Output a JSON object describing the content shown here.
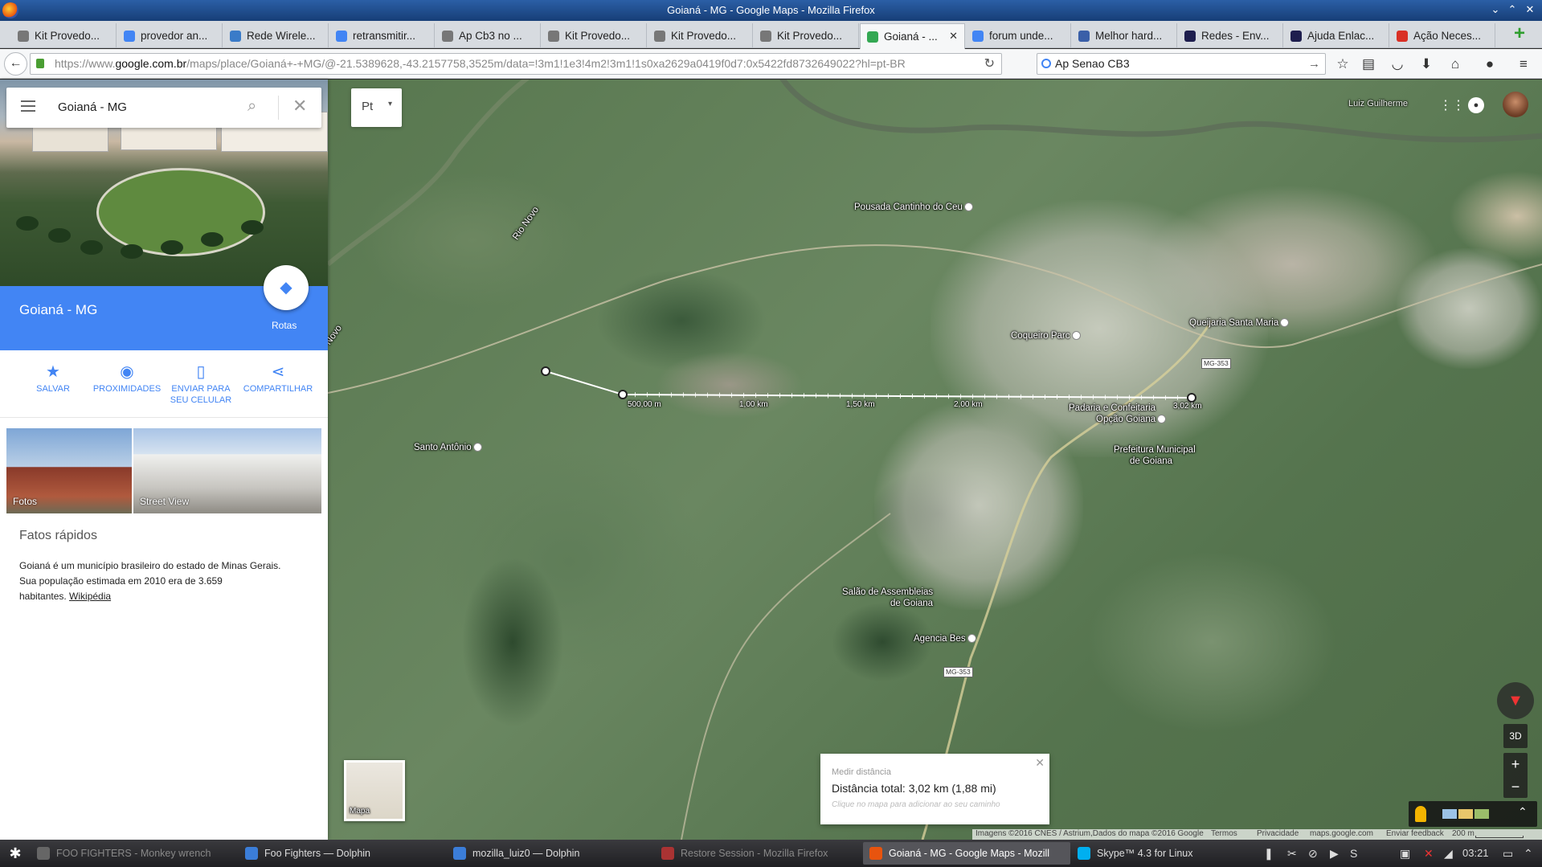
{
  "window_title": "Goianá - MG - Google Maps - Mozilla Firefox",
  "tabs": [
    {
      "label": "Kit Provedo...",
      "fav": "router-icon",
      "color": "#777"
    },
    {
      "label": "provedor an...",
      "fav": "google-icon",
      "color": "#4285f4"
    },
    {
      "label": "Rede Wirele...",
      "fav": "forum-icon",
      "color": "#3a7bc8"
    },
    {
      "label": "retransmitir...",
      "fav": "google-icon",
      "color": "#4285f4"
    },
    {
      "label": "Ap Cb3 no ...",
      "fav": "router-icon",
      "color": "#777"
    },
    {
      "label": "Kit Provedo...",
      "fav": "router-icon",
      "color": "#777"
    },
    {
      "label": "Kit Provedo...",
      "fav": "router-icon",
      "color": "#777"
    },
    {
      "label": "Kit Provedo...",
      "fav": "router-icon",
      "color": "#777"
    },
    {
      "label": "Goianá - ...",
      "fav": "maps-icon",
      "color": "#34a853",
      "active": true
    },
    {
      "label": "forum unde...",
      "fav": "google-icon",
      "color": "#4285f4"
    },
    {
      "label": "Melhor hard...",
      "fav": "monitor-icon",
      "color": "#3a5fa8"
    },
    {
      "label": "Redes - Env...",
      "fav": "vscode-icon",
      "color": "#1e1e4e"
    },
    {
      "label": "Ajuda Enlac...",
      "fav": "vscode-icon",
      "color": "#1e1e4e"
    },
    {
      "label": "Ação Neces...",
      "fav": "gmail-icon",
      "color": "#d93025"
    }
  ],
  "nav": {
    "url_prefix": "https://www.",
    "url_domain": "google.com.br",
    "url_rest": "/maps/place/Goianá+-+MG/@-21.5389628,-43.2157758,3525m/data=!3m1!1e3!4m2!3m1!1s0xa2629a0419f0d7:0x5422fd8732649022?hl=pt-BR",
    "search_value": "Ap Senao CB3"
  },
  "panel": {
    "search_query": "Goianá - MG",
    "place_title": "Goianá - MG",
    "route_label": "Rotas",
    "actions": [
      {
        "label": "SALVAR",
        "icon": "star-icon"
      },
      {
        "label": "PROXIMIDADES",
        "icon": "pin-icon"
      },
      {
        "label": "ENVIAR PARA SEU CELULAR",
        "icon": "phone-icon"
      },
      {
        "label": "COMPARTILHAR",
        "icon": "share-icon"
      }
    ],
    "photos_label": "Fotos",
    "streetview_label": "Street View",
    "facts_title": "Fatos rápidos",
    "facts_line1": "Goianá é um município brasileiro do estado de Minas Gerais.",
    "facts_line2": "Sua população estimada em 2010 era de 3.659",
    "facts_line3_prefix": "habitantes. ",
    "facts_link": "Wikipédia"
  },
  "map": {
    "language": "Pt",
    "user_name": "Luiz Guilherme",
    "labels": {
      "river1": "Rio Novo",
      "river2": "Novo",
      "pousada": "Pousada Cantinho do Ceu",
      "coqueiro": "Coqueiro Parc",
      "queijaria": "Queijaria Santa Maria",
      "padaria1": "Padaria e Confeitaria",
      "padaria2": "Opção Goiana",
      "prefeitura1": "Prefeitura Municipal",
      "prefeitura2": "de Goiana",
      "santo": "Santo Antônio",
      "salao1": "Salão de Assembleias",
      "salao2": "de Goiana",
      "agencia": "Agencia Bes",
      "road1": "MG-353",
      "road2": "MG-353"
    },
    "ruler_ticks": [
      "500,00 m",
      "1,00 km",
      "1,50 km",
      "2,00 km",
      "3,02 km"
    ],
    "minimap_label": "Mapa",
    "measure_title": "Medir distância",
    "measure_total": "Distância total: 3,02 km (1,88 mi)",
    "measure_hint": "Clique no mapa para adicionar ao seu caminho",
    "btn_3d": "3D",
    "zoom_in": "+",
    "zoom_out": "−",
    "footer": {
      "imagery": "Imagens ©2016 CNES / Astrium,Dados do mapa ©2016 Google",
      "terms": "Termos",
      "privacy": "Privacidade",
      "domain": "maps.google.com",
      "feedback": "Enviar feedback",
      "scale": "200 m"
    }
  },
  "taskbar": {
    "tasks": [
      {
        "label": "FOO FIGHTERS - Monkey wrench",
        "dim": true,
        "color": "#666"
      },
      {
        "label": "Foo Fighters — Dolphin",
        "color": "#3b7dd8"
      },
      {
        "label": "mozilla_luiz0 — Dolphin",
        "color": "#3b7dd8"
      },
      {
        "label": "Restore Session - Mozilla Firefox",
        "dim": true,
        "color": "#a33"
      },
      {
        "label": "Goianá - MG - Google Maps - Mozill",
        "active": true,
        "color": "#e8540e"
      },
      {
        "label": "Skype™ 4.3 for Linux",
        "color": "#00aff0"
      }
    ],
    "clock": "03:21"
  }
}
